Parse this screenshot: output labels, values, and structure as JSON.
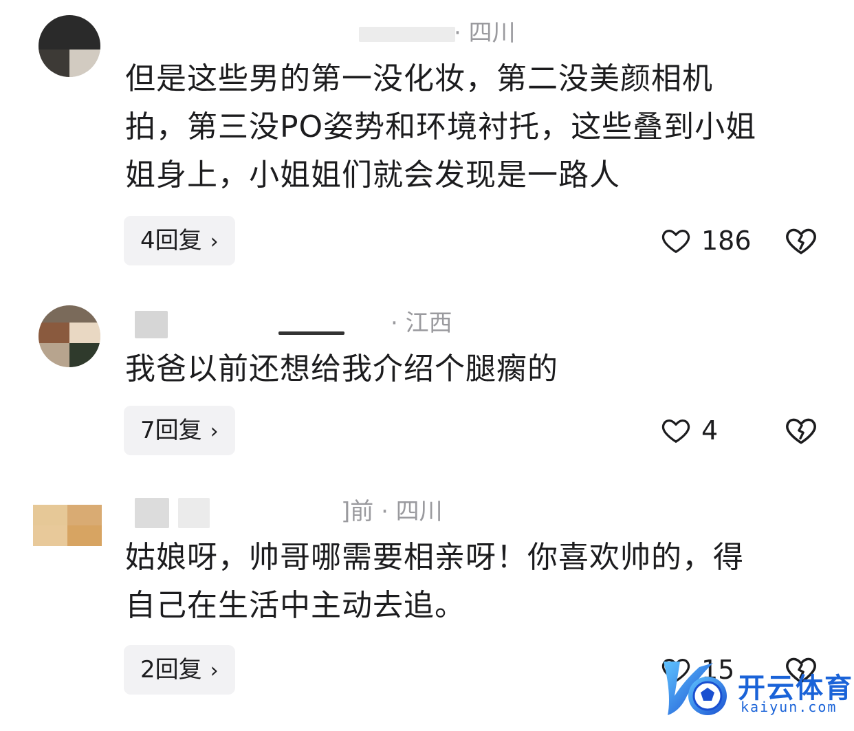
{
  "comments": [
    {
      "location": "· 四川",
      "text_lines": [
        "但是这些男的第一没化妆，第二没美颜相机",
        "拍，第三没PO姿势和环境衬托，这些叠到小姐",
        "姐身上，小姐姐们就会发现是一路人"
      ],
      "reply_label": "4回复",
      "chevron": "›",
      "likes": "186"
    },
    {
      "location": "· 江西",
      "text_lines": [
        "我爸以前还想给我介绍个腿瘸的"
      ],
      "reply_label": "7回复",
      "chevron": "›",
      "likes": "4"
    },
    {
      "location": "]前 · 四川",
      "text_lines": [
        "姑娘呀，帅哥哪需要相亲呀！你喜欢帅的，得",
        "自己在生活中主动去追。"
      ],
      "reply_label": "2回复",
      "chevron": "›",
      "likes": "15"
    }
  ],
  "watermark": {
    "brand": "开云体育",
    "url": "kaiyun.com"
  },
  "icons": {
    "like": "heart-outline-icon",
    "dislike": "broken-heart-icon",
    "reply_chevron": "chevron-right-icon"
  },
  "colors": {
    "text": "#1c1c1e",
    "meta": "#9a9a9e",
    "reply_bg": "#f2f2f4",
    "watermark": "#1a63d8"
  }
}
